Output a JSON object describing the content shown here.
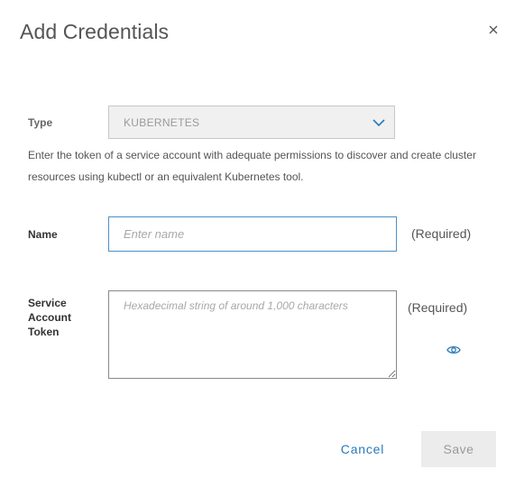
{
  "dialog": {
    "title": "Add Credentials",
    "close_icon": "close-icon"
  },
  "type_field": {
    "label": "Type",
    "selected_value": "KUBERNETES",
    "chevron_icon": "chevron-down-icon",
    "help_text": "Enter the token of a service account with adequate permissions to discover and create cluster resources using kubectl or an equivalent Kubernetes tool."
  },
  "name_field": {
    "label": "Name",
    "value": "",
    "placeholder": "Enter name",
    "required_text": "(Required)"
  },
  "token_field": {
    "label": "Service Account Token",
    "value": "",
    "placeholder": "Hexadecimal string of around 1,000 characters",
    "required_text": "(Required)",
    "reveal_icon": "eye-icon"
  },
  "actions": {
    "cancel_label": "Cancel",
    "save_label": "Save"
  },
  "colors": {
    "accent": "#2a7ab8",
    "input_focus_border": "#4a90c8",
    "disabled_bg": "#ececec"
  }
}
